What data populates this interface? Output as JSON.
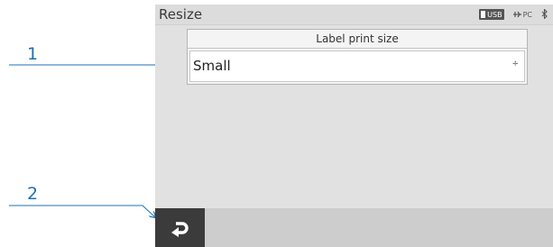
{
  "callouts": {
    "one": "1",
    "two": "2"
  },
  "screen": {
    "title": "Resize",
    "status": {
      "usb_label": "USB",
      "pc_label": "PC"
    },
    "panel": {
      "header": "Label print size",
      "selected_value": "Small",
      "selector_glyph": "÷"
    }
  },
  "colors": {
    "callout": "#1f6fb3",
    "screen_bg": "#e1e1e1",
    "back_button": "#3b3b3b"
  },
  "icons": {
    "back": "return-arrow-icon",
    "bluetooth": "bluetooth-icon",
    "usb": "usb-icon",
    "pc": "pc-link-icon"
  }
}
